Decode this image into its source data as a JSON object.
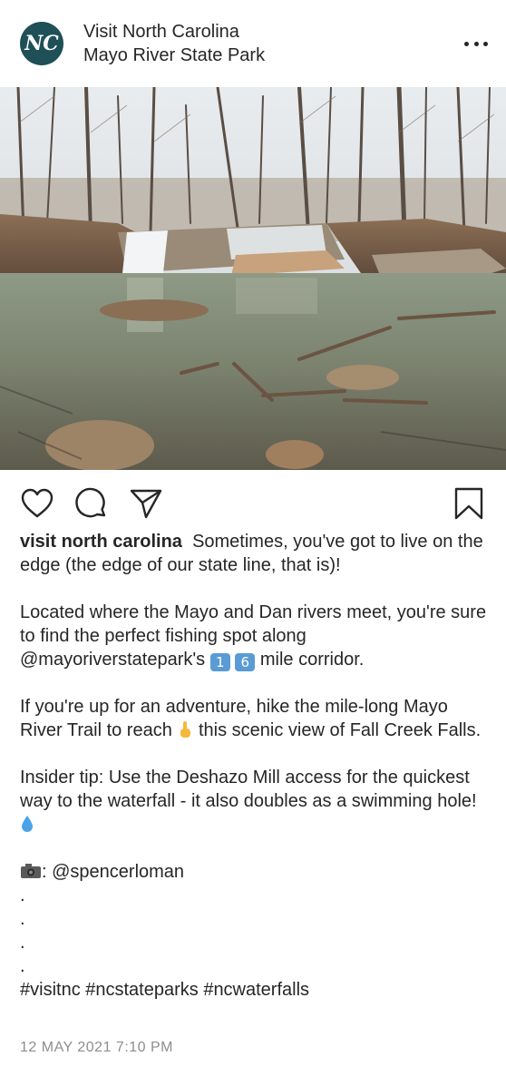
{
  "header": {
    "logo_text": "NC",
    "account_name": "Visit North Carolina",
    "location": "Mayo River State Park",
    "more_icon": "more-horizontal-icon"
  },
  "photo": {
    "alt": "Waterfall"
  },
  "actions": {
    "like_icon": "heart-icon",
    "comment_icon": "comment-icon",
    "share_icon": "send-icon",
    "save_icon": "bookmark-icon"
  },
  "caption": {
    "username": "visit north carolina",
    "line1": "Sometimes, you've got to live on the edge (the edge of our state line, that is)!",
    "para2_a": "Located where the Mayo and Dan rivers meet, you're sure to find the perfect fishing spot along @mayoriverstatepark's",
    "para2_num1": "1",
    "para2_num2": "6",
    "para2_b": "mile corridor.",
    "para3_a": "If you're up for an adventure, hike the mile-long Mayo River Trail to reach",
    "para3_b": "this scenic view of Fall Creek Falls.",
    "para4": "Insider tip: Use the Deshazo Mill access for the quickest way to the waterfall - it also doubles as a swimming hole!",
    "credit": ": @spencerloman",
    "dots": [
      ".",
      ".",
      ".",
      "."
    ],
    "hashtags": "#visitnc #ncstateparks #ncwaterfalls"
  },
  "timestamp": "12 MAY 2021 7:10 PM",
  "colors": {
    "text": "#262626",
    "muted": "#8e8e8e",
    "avatar_bg": "#1f4f57"
  }
}
